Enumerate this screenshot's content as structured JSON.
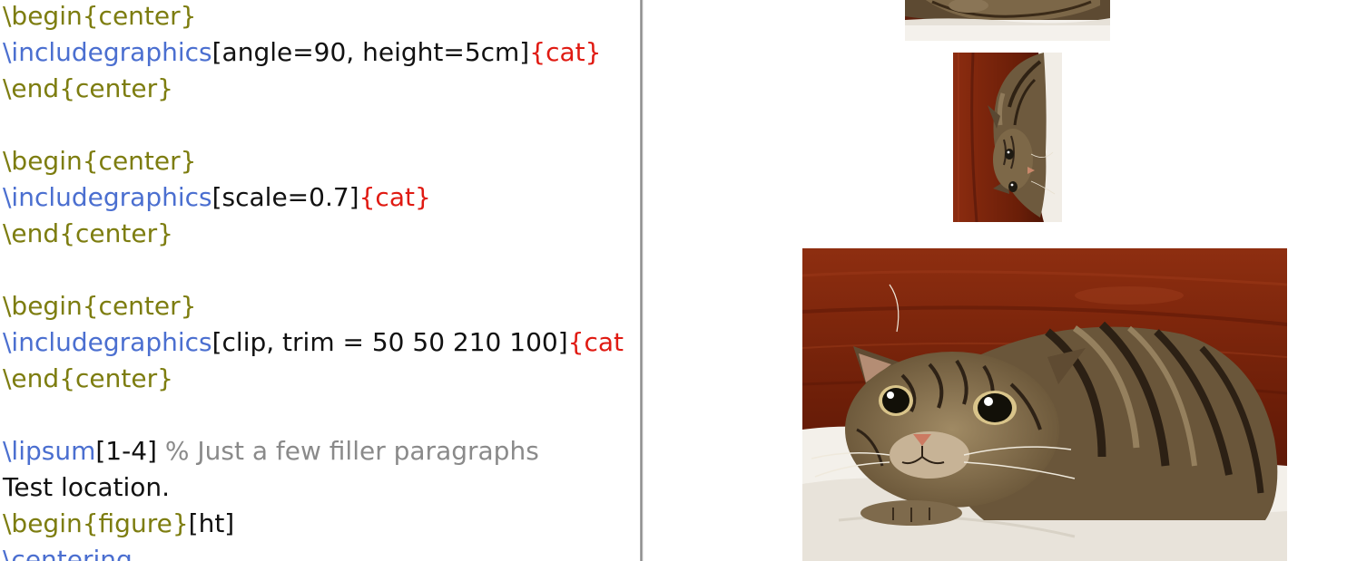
{
  "editor": {
    "lines": [
      {
        "env_cmd": "\\begin",
        "env_arg": "{center}"
      },
      {
        "cmd": "\\includegraphics",
        "opts": "[angle=90, height=5cm]",
        "file": "cat"
      },
      {
        "env_cmd": "\\end",
        "env_arg": "{center}"
      },
      {
        "env_cmd": "\\begin",
        "env_arg": "{center}"
      },
      {
        "cmd": "\\includegraphics",
        "opts": "[scale=0.7]",
        "file": "cat"
      },
      {
        "env_cmd": "\\end",
        "env_arg": "{center}"
      },
      {
        "env_cmd": "\\begin",
        "env_arg": "{center}"
      },
      {
        "cmd": "\\includegraphics",
        "opts": "[clip, trim = 50 50 210 100]",
        "file": "cat"
      },
      {
        "env_cmd": "\\end",
        "env_arg": "{center}"
      },
      {
        "cmd": "\\lipsum",
        "opts": "[1-4]",
        "comment": " % Just a few filler paragraphs"
      },
      {
        "text": "Test location."
      },
      {
        "env_cmd": "\\begin",
        "env_arg": "{figure}",
        "opts": "[ht]"
      },
      {
        "cmd": "\\centering"
      }
    ],
    "brace_open": "{",
    "brace_close": "}"
  },
  "preview": {
    "images": [
      {
        "name": "cat-photo-clipped-top"
      },
      {
        "name": "cat-photo-rotated-90"
      },
      {
        "name": "cat-photo-scaled-0.7"
      }
    ]
  },
  "colors": {
    "environment": "#7d7d10",
    "command": "#4b6fd0",
    "brace": "#e01a12",
    "comment": "#8a8a8a",
    "text": "#111111",
    "background": "#ffffff"
  }
}
